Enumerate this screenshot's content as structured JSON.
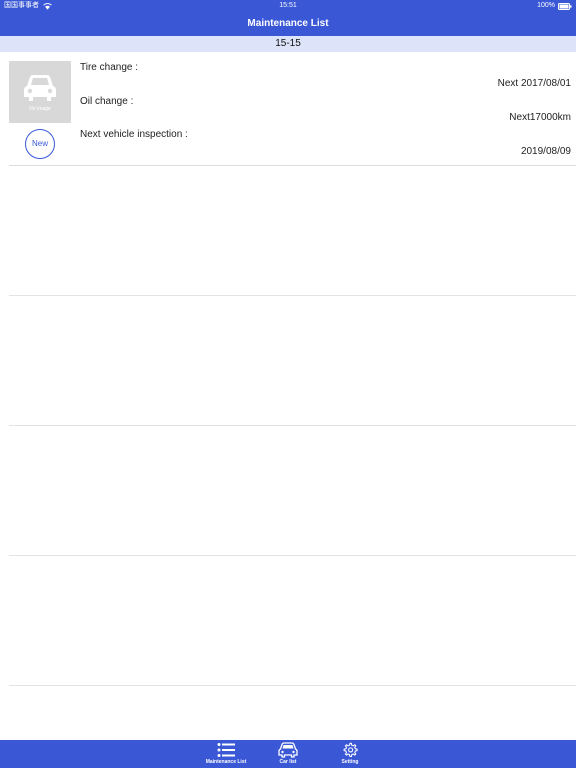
{
  "colors": {
    "accent": "#3a57d6"
  },
  "status_bar": {
    "carrier": "国国事事者",
    "time": "15:51",
    "battery": "100%"
  },
  "nav": {
    "title": "Maintenance List"
  },
  "section": {
    "header": "15-15"
  },
  "car": {
    "image_placeholder": "No Image",
    "new_label": "New",
    "items": [
      {
        "label": "Tire change :",
        "value": "Next 2017/08/01"
      },
      {
        "label": "Oil change :",
        "value": "Next17000km"
      },
      {
        "label": "Next vehicle inspection :",
        "value": "2019/08/09"
      }
    ]
  },
  "tabs": [
    {
      "label": "Maintenance List",
      "icon": "list-icon"
    },
    {
      "label": "Car list",
      "icon": "car-icon"
    },
    {
      "label": "Setting",
      "icon": "gear-icon"
    }
  ]
}
